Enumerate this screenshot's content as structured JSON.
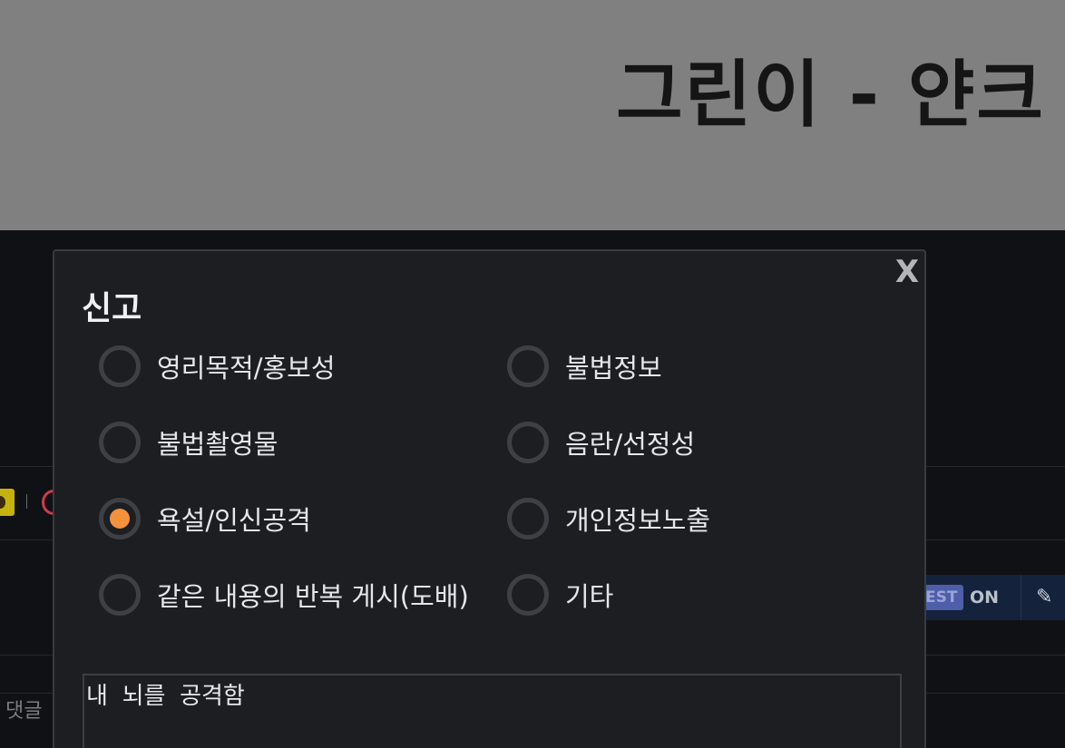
{
  "banner": {
    "title": "그린이 - 얀크"
  },
  "background": {
    "best_label": "EST",
    "on_label": "ON",
    "comment_placeholder": "댓글"
  },
  "modal": {
    "title": "신고",
    "close_label": "X",
    "options": [
      {
        "label": "영리목적/홍보성",
        "checked": false
      },
      {
        "label": "불법정보",
        "checked": false
      },
      {
        "label": "불법촬영물",
        "checked": false
      },
      {
        "label": "음란/선정성",
        "checked": false
      },
      {
        "label": "욕설/인신공격",
        "checked": true
      },
      {
        "label": "개인정보노출",
        "checked": false
      },
      {
        "label": "같은 내용의 반복 게시(도배)",
        "checked": false
      },
      {
        "label": "기타",
        "checked": false
      }
    ],
    "reason_value": "내 뇌를 공격함",
    "accent_color": "#f4913d"
  }
}
